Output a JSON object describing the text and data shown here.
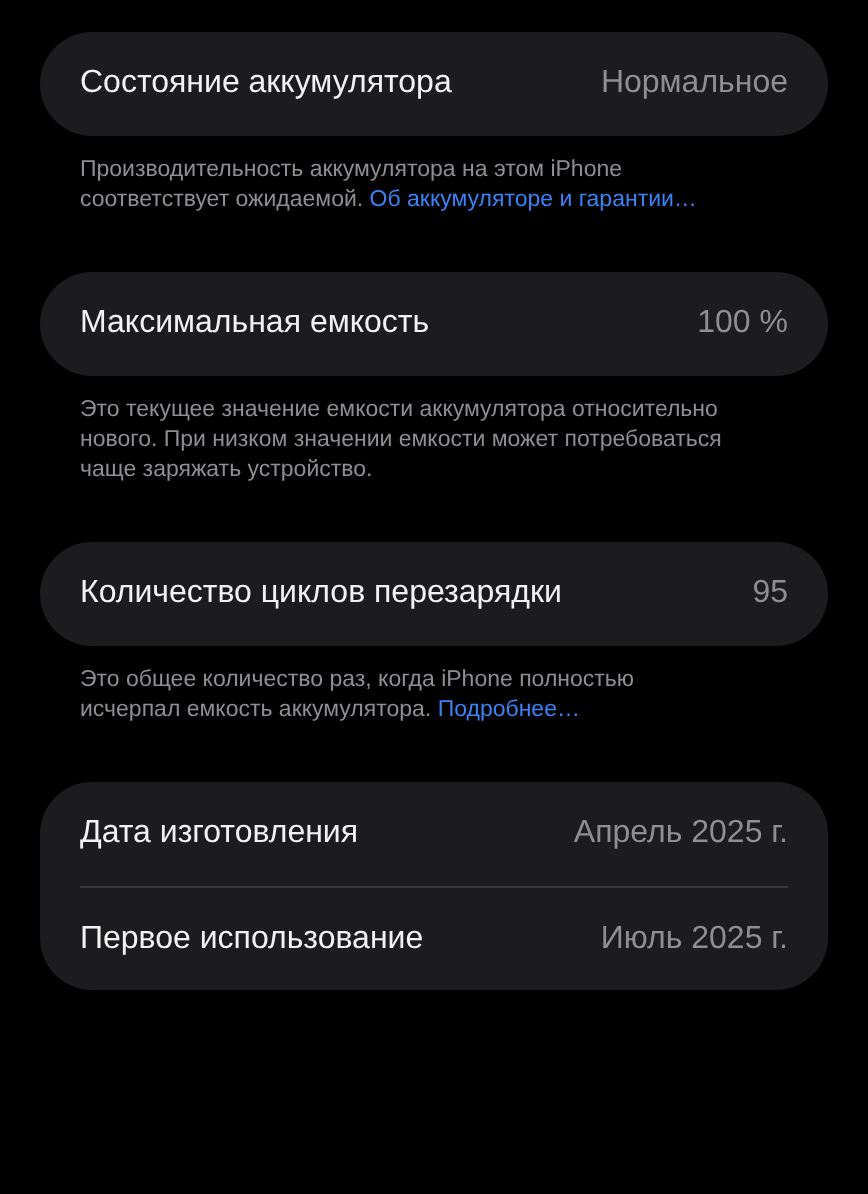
{
  "sections": [
    {
      "rows": [
        {
          "label": "Состояние аккумулятора",
          "value": "Нормальное"
        }
      ],
      "footer": {
        "text": "Производительность аккумулятора на этом iPhone соответствует ожидаемой.",
        "link": "Об аккумуляторе и гарантии…"
      }
    },
    {
      "rows": [
        {
          "label": "Максимальная емкость",
          "value": "100 %"
        }
      ],
      "footer": {
        "text": "Это текущее значение емкости аккумулятора относительно нового. При низком значении емкости может потребоваться чаще заряжать устройство."
      }
    },
    {
      "rows": [
        {
          "label": "Количество циклов перезарядки",
          "value": "95"
        }
      ],
      "footer": {
        "text": "Это общее количество раз, когда iPhone полностью исчерпал емкость аккумулятора.",
        "link": "Подробнее…"
      }
    },
    {
      "rows": [
        {
          "label": "Дата изготовления",
          "value": "Апрель 2025 г."
        },
        {
          "label": "Первое использование",
          "value": "Июль 2025 г."
        }
      ]
    }
  ]
}
